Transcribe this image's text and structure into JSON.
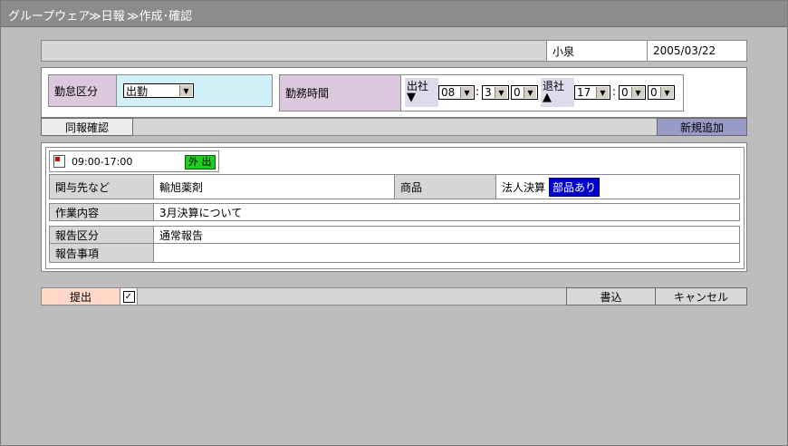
{
  "header": {
    "app": "グループウェア",
    "crumb1": "≫日報",
    "crumb2": "≫作成･確認"
  },
  "info": {
    "name": "小泉",
    "date": "2005/03/22"
  },
  "attendance": {
    "kubun_label": "勤怠区分",
    "kubun_value": "出勤",
    "time_label": "勤務時間",
    "in_label": "出社",
    "in_hour": "08",
    "in_min1": "3",
    "in_min2": "0",
    "out_label": "退社",
    "out_hour": "17",
    "out_min1": "0",
    "out_min2": "0",
    "colon": ":"
  },
  "toolbar": {
    "doho_label": "同報確認",
    "add_label": "新規追加"
  },
  "entry": {
    "time": "09:00-17:00",
    "badge": "外 出",
    "client_label": "関与先など",
    "client_value": "輸旭薬剤",
    "product_label": "商品",
    "product_value": "法人決算",
    "product_badge": "部品あり",
    "work_label": "作業内容",
    "work_value": "3月決算について",
    "report_kubun_label": "報告区分",
    "report_kubun_value": "通常報告",
    "report_item_label": "報告事項",
    "report_item_value": ""
  },
  "footer": {
    "submit_label": "提出",
    "write_label": "書込",
    "cancel_label": "キャンセル"
  },
  "colors": {
    "accent_blue": "#0000cc",
    "badge_green": "#22cc22"
  }
}
